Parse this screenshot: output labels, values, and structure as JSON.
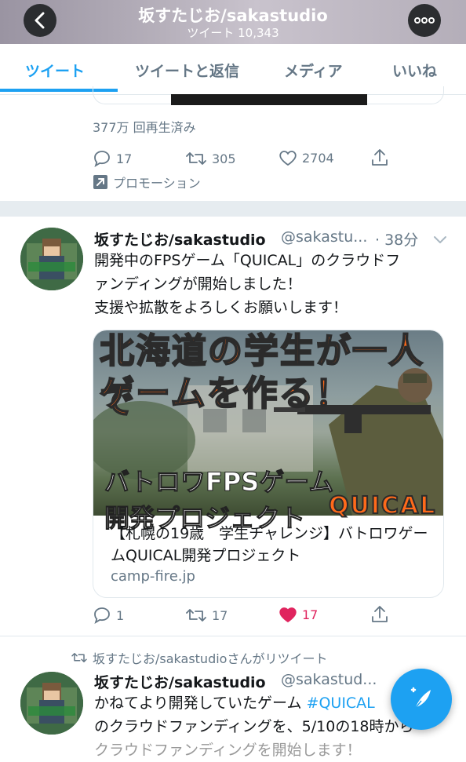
{
  "header": {
    "title": "坂すたじお/sakastudio",
    "subtitle": "ツイート 10,343"
  },
  "tabs": [
    {
      "label": "ツイート"
    },
    {
      "label": "ツイートと返信"
    },
    {
      "label": "メディア"
    },
    {
      "label": "いいね"
    }
  ],
  "promoted": {
    "views": "377万 回再生済み",
    "reply_count": "17",
    "retweet_count": "305",
    "like_count": "2704",
    "promotion_label": "プロモーション"
  },
  "tweet1": {
    "name": "坂すたじお/sakastudio",
    "handle": "@sakastu...",
    "time": "· 38分",
    "text_lines": [
      "開発中のFPSゲーム「QUICAL」のクラウドフ",
      "ァンディングが開始しました！",
      "支援や拡散をよろしくお願いします！"
    ],
    "card": {
      "banner_line1": "北海道の学生が一人で",
      "banner_line2": "ゲームを作る！",
      "banner_line3": "バトロワFPSゲーム",
      "banner_line4": "開発プロジェクト",
      "banner_logo": "QUICAL",
      "title": "【札幌の19歳　学生チャレンジ】バトロワゲームQUICAL開発プロジェクト",
      "domain": "camp-fire.jp"
    },
    "reply_count": "1",
    "retweet_count": "17",
    "like_count": "17",
    "like_color": "#e0245e"
  },
  "tweet2": {
    "retweet_label": "坂すたじお/sakastudioさんがリツイート",
    "name": "坂すたじお/sakastudio",
    "handle": "@sakastud...",
    "text_line1_prefix": "かねてより開発していたゲーム ",
    "text_line1_hashtag": "#QUICAL",
    "text_line2": "のクラウドファンディングを、5/10の18時から",
    "text_line3": "クラウドファンディングを開始します！"
  },
  "colors": {
    "accent": "#1da1f2",
    "muted": "#657786"
  },
  "icons": [
    "back-arrow-icon",
    "more-icon",
    "reply-icon",
    "retweet-icon",
    "heart-icon",
    "share-icon",
    "promoted-arrow-icon",
    "compose-feather-icon"
  ]
}
